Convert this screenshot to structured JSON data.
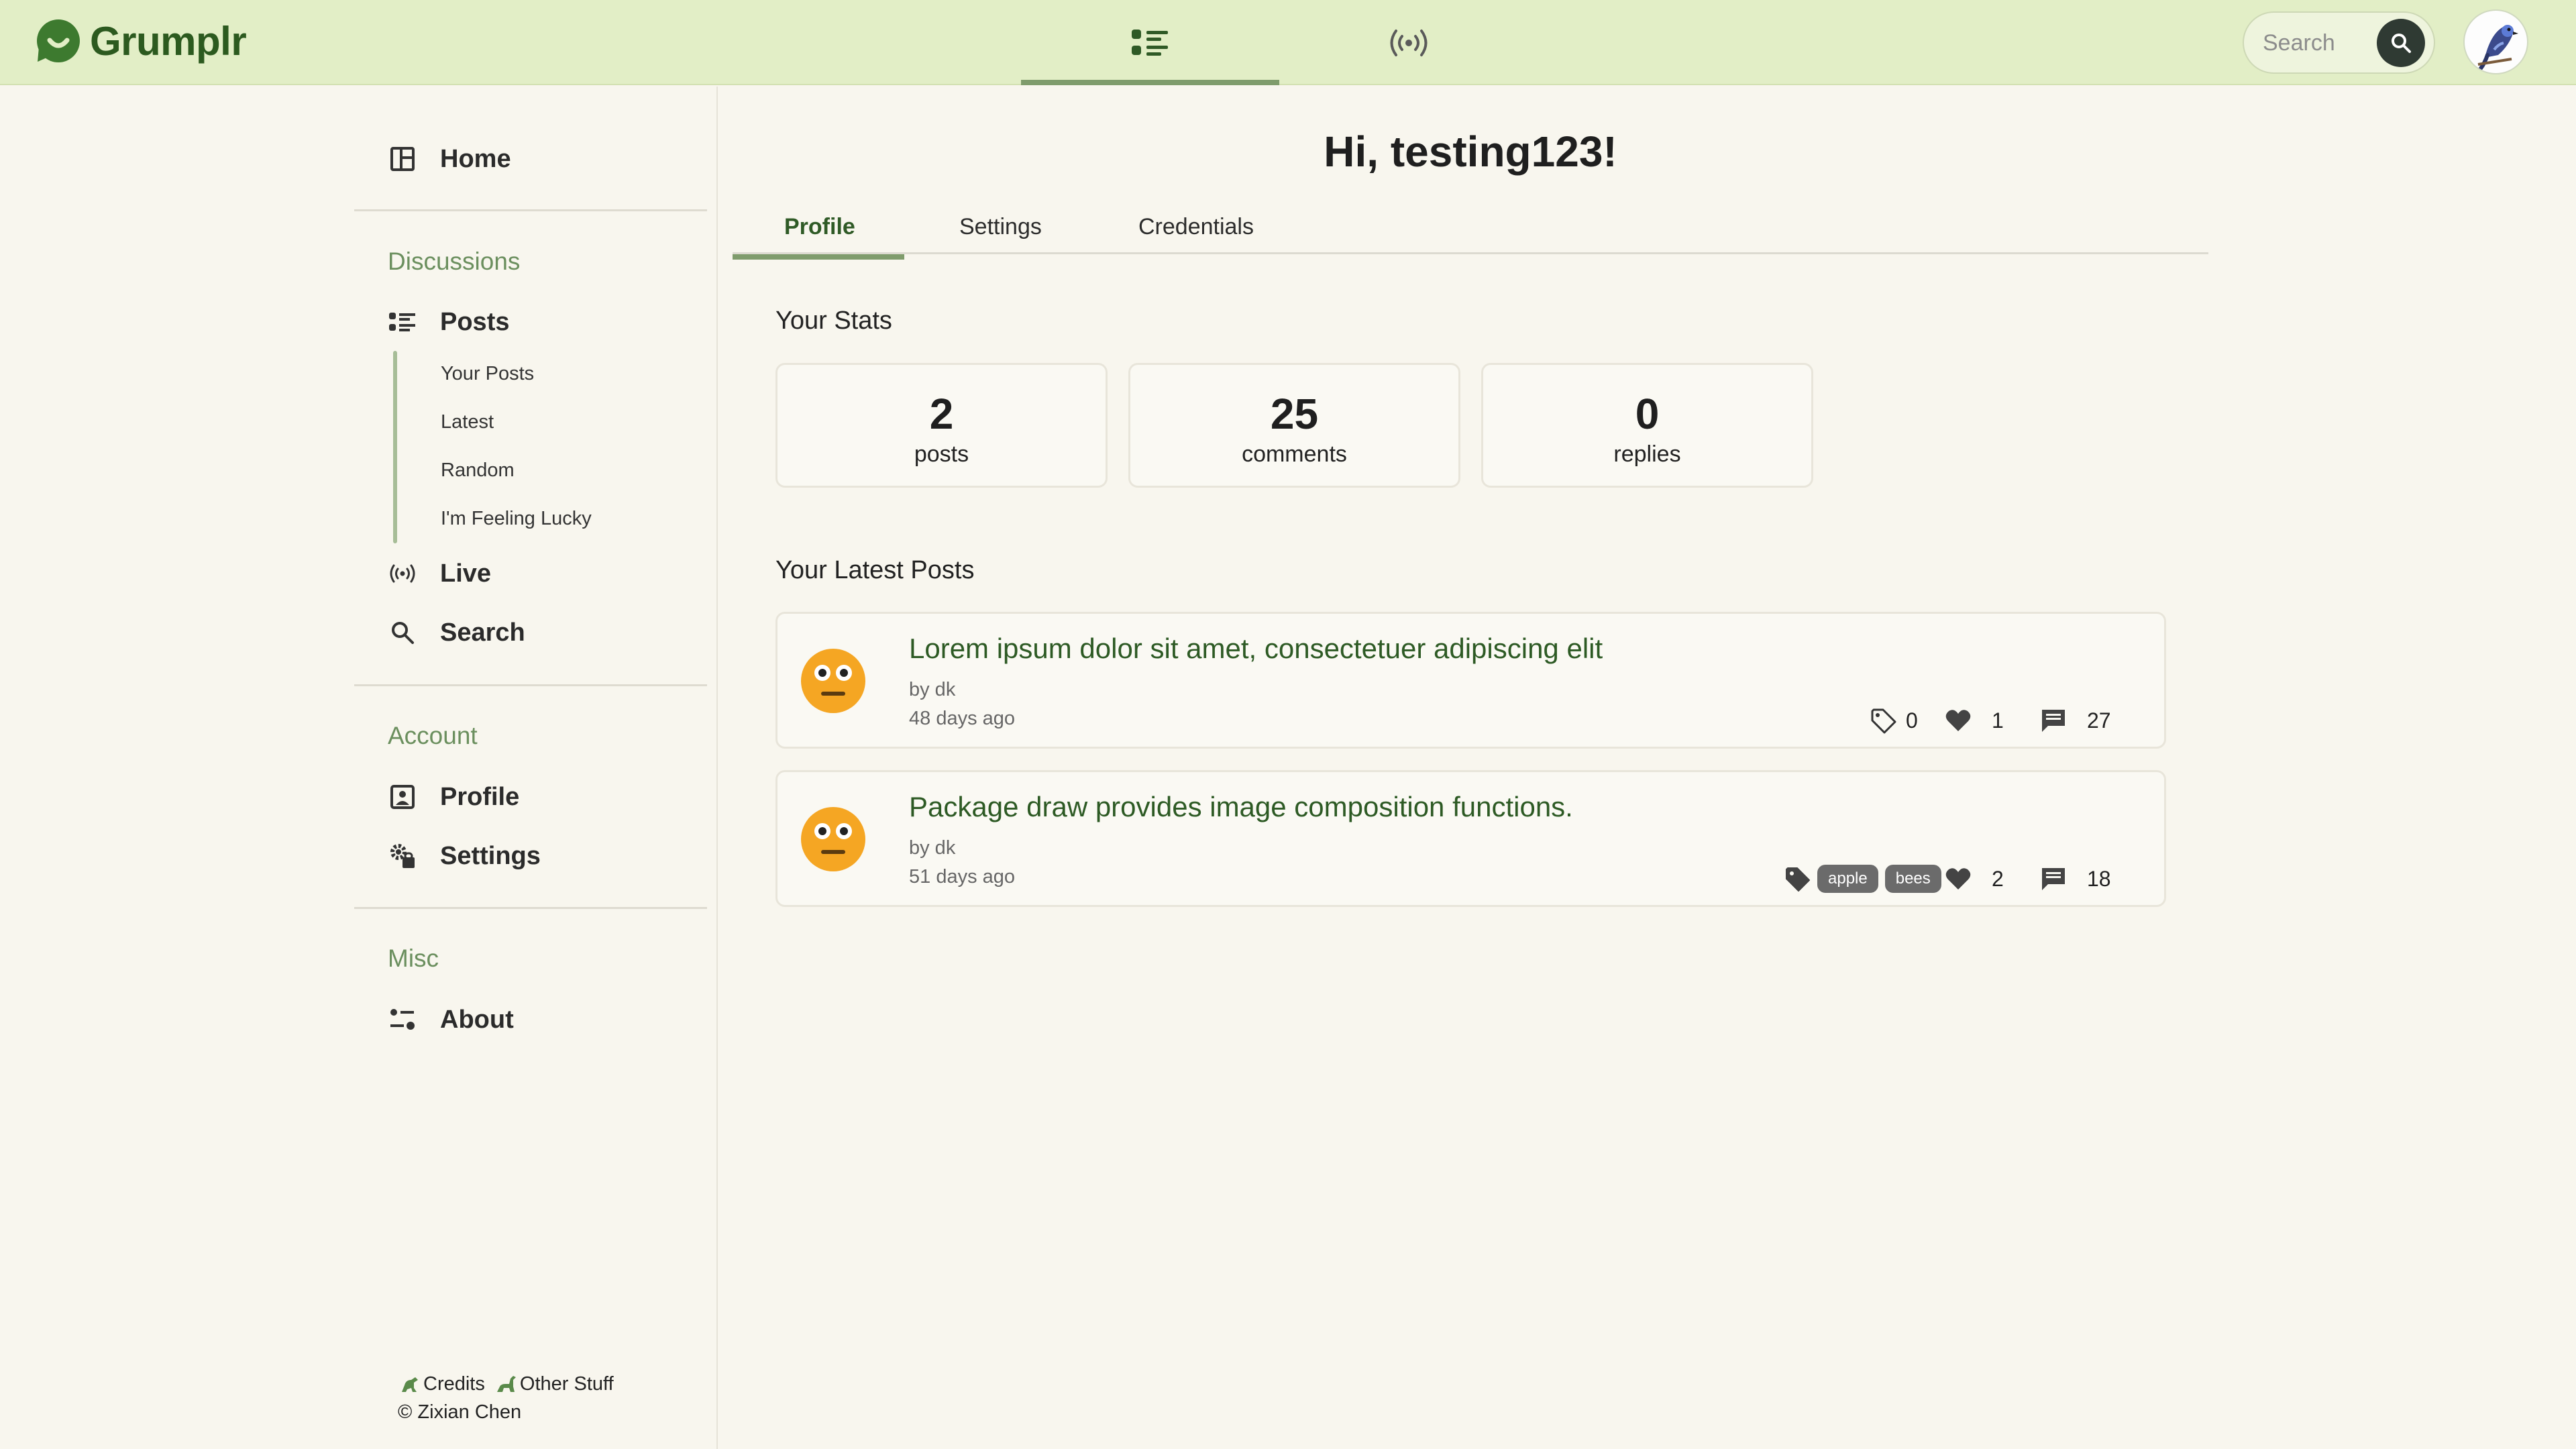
{
  "app": {
    "name": "Grumplr"
  },
  "header": {
    "nav": [
      {
        "icon": "posts-list-icon",
        "active": true
      },
      {
        "icon": "live-broadcast-icon",
        "active": false
      }
    ],
    "search": {
      "placeholder": "Search"
    }
  },
  "sidebar": {
    "home": "Home",
    "discussions": {
      "heading": "Discussions",
      "posts": "Posts",
      "sub": [
        "Your Posts",
        "Latest",
        "Random",
        "I'm Feeling Lucky"
      ],
      "live": "Live",
      "search": "Search"
    },
    "account": {
      "heading": "Account",
      "profile": "Profile",
      "settings": "Settings"
    },
    "misc": {
      "heading": "Misc",
      "about": "About"
    },
    "footer": {
      "credits": "Credits",
      "other": "Other Stuff",
      "copyright": "© Zixian Chen"
    }
  },
  "main": {
    "greeting": "Hi, testing123!",
    "tabs": [
      "Profile",
      "Settings",
      "Credentials"
    ],
    "stats_heading": "Your Stats",
    "stats": [
      {
        "value": "2",
        "label": "posts"
      },
      {
        "value": "25",
        "label": "comments"
      },
      {
        "value": "0",
        "label": "replies"
      }
    ],
    "latest_heading": "Your Latest Posts",
    "posts": [
      {
        "title": "Lorem ipsum dolor sit amet, consectetuer adipiscing elit",
        "author": "by dk",
        "age": "48 days ago",
        "tag_count": "0",
        "tags": [],
        "likes": "1",
        "comments": "27"
      },
      {
        "title": "Package draw provides image composition functions.",
        "author": "by dk",
        "age": "51 days ago",
        "tags": [
          "apple",
          "bees"
        ],
        "likes": "2",
        "comments": "18"
      }
    ]
  },
  "colors": {
    "header_bg": "#e2eec6",
    "page_bg": "#f8f6ee",
    "accent_green": "#2f5a26",
    "section_green": "#6b8f5e",
    "indicator": "#7f9c6c"
  }
}
